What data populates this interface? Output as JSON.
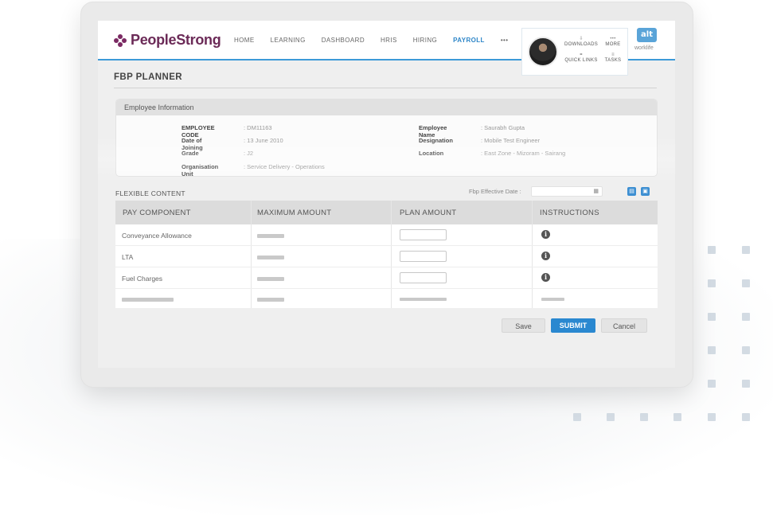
{
  "app": {
    "logo_text": "PeopleStrong",
    "brand_color": "#6b2a57",
    "accent_color": "#2e86c8"
  },
  "nav": {
    "items": [
      {
        "label": "HOME",
        "active": false
      },
      {
        "label": "LEARNING",
        "active": false
      },
      {
        "label": "DASHBOARD",
        "active": false
      },
      {
        "label": "HRIS",
        "active": false
      },
      {
        "label": "HIRING",
        "active": false
      },
      {
        "label": "PAYROLL",
        "active": true
      },
      {
        "label": "•••",
        "active": false
      }
    ]
  },
  "user_menu": {
    "downloads": "DOWNLOADS",
    "more": "MORE",
    "quick_links": "QUICK LINKS",
    "tasks": "TASKS"
  },
  "alt": {
    "badge": "alt",
    "sub": "worklife"
  },
  "page": {
    "title": "FBP PLANNER"
  },
  "employee": {
    "header": "Employee Information",
    "fields_left": [
      {
        "label": "EMPLOYEE CODE",
        "value": ": DM11163"
      },
      {
        "label": "Date of Joining",
        "value": ": 13 June 2010"
      },
      {
        "label": "Grade",
        "value": ": J2"
      },
      {
        "label": "Organisation Unit",
        "value": ": Service Delivery - Operations"
      }
    ],
    "fields_right": [
      {
        "label": "Employee Name",
        "value": ": Saurabh Gupta"
      },
      {
        "label": "Designation",
        "value": ": Mobile Test Engineer"
      },
      {
        "label": "Location",
        "value": ": East Zone - Mizoram - Sairang"
      }
    ]
  },
  "flexible": {
    "title": "FLEXIBLE CONTENT",
    "effective_date_label": "Fbp Effective Date :",
    "effective_date_value": ""
  },
  "table": {
    "headers": [
      "PAY COMPONENT",
      "MAXIMUM AMOUNT",
      "PLAN AMOUNT",
      "INSTRUCTIONS"
    ],
    "rows": [
      {
        "component": "Conveyance Allowance"
      },
      {
        "component": "LTA"
      },
      {
        "component": "Fuel Charges"
      }
    ]
  },
  "actions": {
    "save": "Save",
    "submit": "SUBMIT",
    "cancel": "Cancel"
  }
}
